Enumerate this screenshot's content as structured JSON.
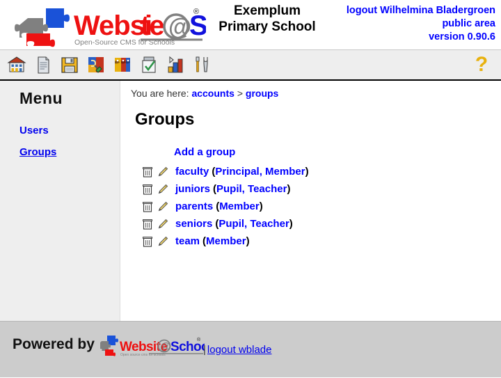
{
  "header": {
    "logo": {
      "word1": "Websi",
      "word1b": "te",
      "at": "@",
      "word2": "School",
      "registered": "®",
      "tagline": "Open-Source CMS for Schools"
    },
    "school_name_line1": "Exemplum",
    "school_name_line2": "Primary School",
    "account": {
      "logout_label": "logout Wilhelmina Bladergroen",
      "area": "public area",
      "version": "version 0.90.6"
    }
  },
  "toolbar": {
    "items": [
      {
        "name": "home-icon",
        "title": "Home"
      },
      {
        "name": "page-icon",
        "title": "Pages"
      },
      {
        "name": "floppy-disk-icon",
        "title": "File manager"
      },
      {
        "name": "puzzle-tools-icon",
        "title": "Modules"
      },
      {
        "name": "users-faces-icon",
        "title": "Account manager"
      },
      {
        "name": "checklist-icon",
        "title": "Tasks"
      },
      {
        "name": "bar-chart-icon",
        "title": "Statistics"
      },
      {
        "name": "tools-icon",
        "title": "Tools"
      }
    ],
    "help_label": "?"
  },
  "sidebar": {
    "title": "Menu",
    "items": [
      {
        "label": "Users",
        "current": false
      },
      {
        "label": "Groups",
        "current": true
      }
    ]
  },
  "content": {
    "breadcrumb": {
      "prefix": "You are here:",
      "crumbs": [
        "accounts",
        "groups"
      ],
      "separator": ">"
    },
    "page_title": "Groups",
    "add_link": "Add a group",
    "groups": [
      {
        "name": "faculty",
        "roles": "(Principal, Member)",
        "open": "(",
        "role_text": "Principal, Member",
        "close": ")"
      },
      {
        "name": "juniors",
        "roles": "(Pupil, Teacher)",
        "open": "(",
        "role_text": "Pupil, Teacher",
        "close": ")"
      },
      {
        "name": "parents",
        "roles": "(Member)",
        "open": "(",
        "role_text": "Member",
        "close": ")"
      },
      {
        "name": "seniors",
        "roles": "(Pupil, Teacher)",
        "open": "(",
        "role_text": "Pupil, Teacher",
        "close": ")"
      },
      {
        "name": "team",
        "roles": "(Member)",
        "open": "(",
        "role_text": "Member",
        "close": ")"
      }
    ],
    "row_icons": {
      "delete": "trash-icon",
      "edit": "pencil-icon"
    }
  },
  "footer": {
    "powered_by": "Powered by",
    "logo_tagline": "Open source cms for schools",
    "separator": "|",
    "logout_label": "logout wblade"
  },
  "colors": {
    "link_blue": "#0000ff",
    "logo_red": "#ee1111",
    "logo_blue": "#1111dd",
    "logo_gray": "#808080",
    "toolbar_bg": "#eeeeee",
    "sidebar_bg": "#eeeeee",
    "footer_bg": "#cccccc",
    "help_yellow": "#e8b10e"
  }
}
